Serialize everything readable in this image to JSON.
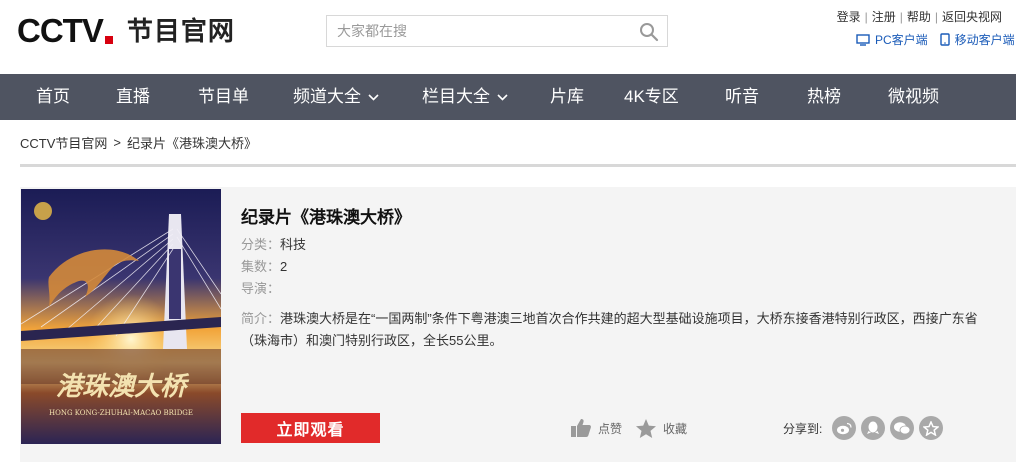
{
  "header": {
    "logo_text": "CCTV",
    "site_name": "节目官网",
    "search_placeholder": "大家都在搜",
    "links": [
      "登录",
      "注册",
      "帮助",
      "返回央视网"
    ],
    "clients": [
      "PC客户端",
      "移动客户端"
    ]
  },
  "nav": {
    "items": [
      "首页",
      "直播",
      "节目单",
      "频道大全",
      "栏目大全",
      "片库",
      "4K专区",
      "听音",
      "热榜",
      "微视频"
    ]
  },
  "breadcrumb": {
    "home": "CCTV节目官网",
    "separator": ">",
    "current": "纪录片《港珠澳大桥》"
  },
  "program": {
    "title": "纪录片《港珠澳大桥》",
    "category_label": "分类：",
    "category": "科技",
    "episodes_label": "集数：",
    "episodes": "2",
    "director_label": "导演：",
    "director": "",
    "intro_label": "简介：",
    "intro": "港珠澳大桥是在“一国两制”条件下粤港澳三地首次合作共建的超大型基础设施项目，大桥东接香港特别行政区，西接广东省（珠海市）和澳门特别行政区，全长55公里。",
    "poster_title": "港珠澳大桥",
    "poster_subtitle": "HONG KONG-ZHUHAI-MACAO BRIDGE",
    "watch_label": "立即观看",
    "like_label": "点赞",
    "fav_label": "收藏",
    "share_label": "分享到:"
  },
  "colors": {
    "nav_bg": "#4f5461",
    "accent_red": "#e12a2a",
    "link_blue": "#1a5bb8",
    "panel_bg": "#f4f4f4"
  }
}
